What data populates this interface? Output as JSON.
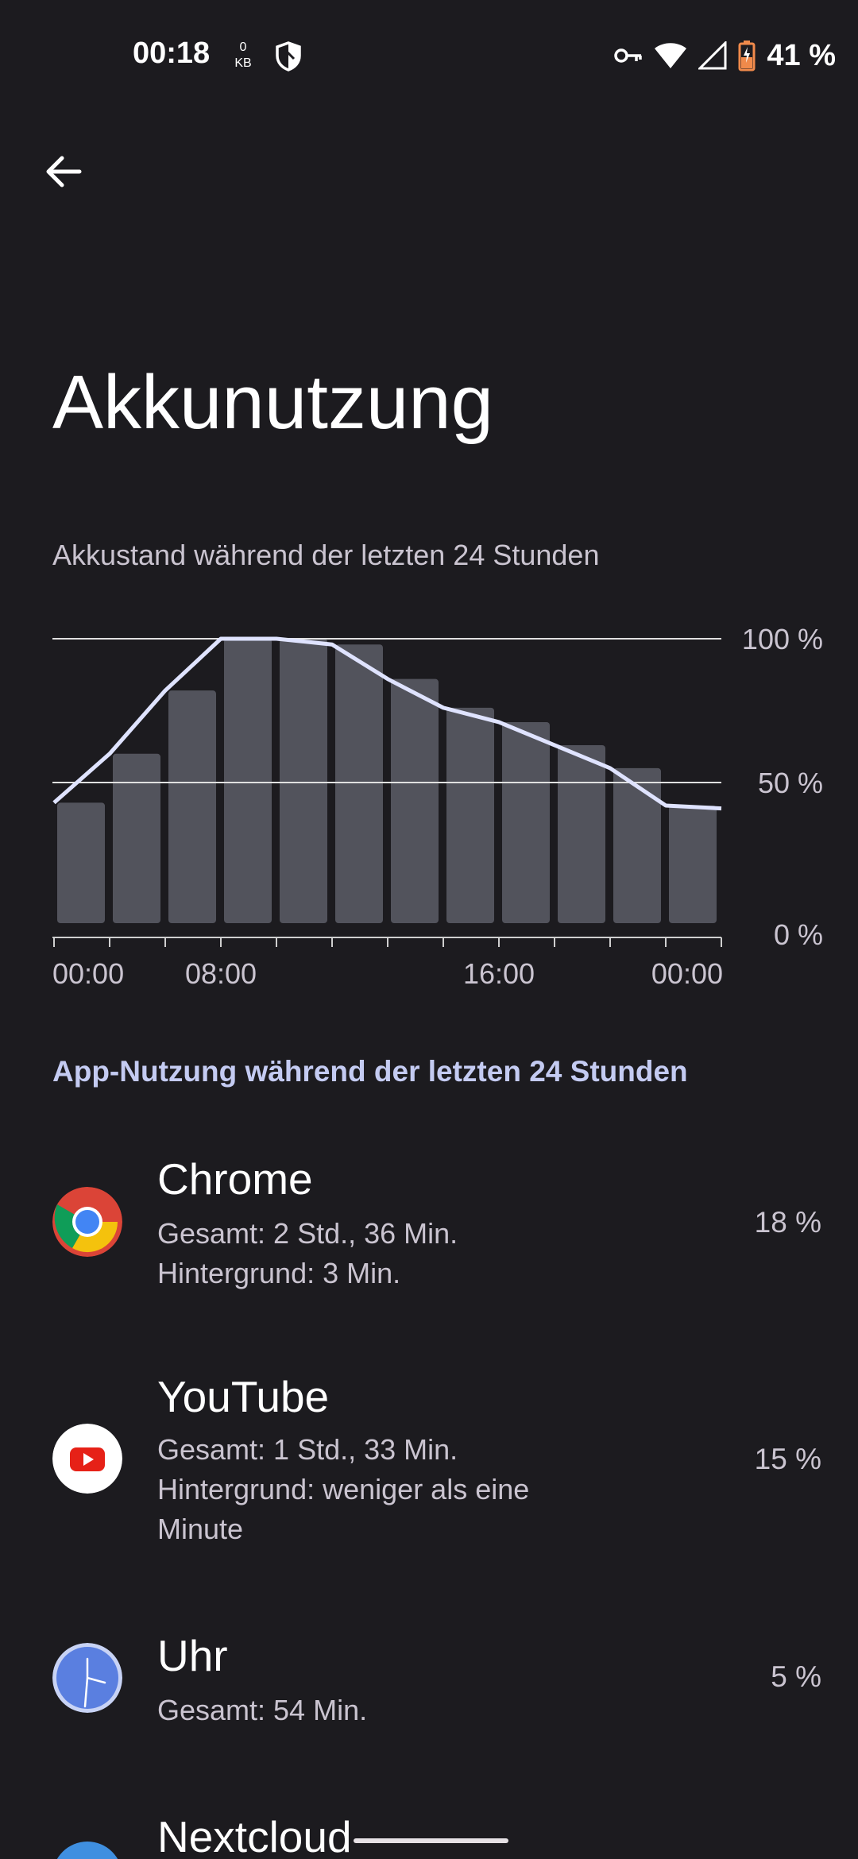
{
  "status_bar": {
    "time": "00:18",
    "data_speed_value": "0",
    "data_speed_unit": "KB",
    "battery_percent": "41 %",
    "icons": [
      "shield-icon",
      "vpn-key-icon",
      "wifi-icon",
      "cell-signal-icon",
      "battery-charging-icon"
    ]
  },
  "header": {
    "back_icon": "arrow-back-icon",
    "title": "Akkunutzung"
  },
  "battery_chart": {
    "caption": "Akkustand während der letzten 24 Stunden"
  },
  "chart_data": {
    "type": "area",
    "title": "Akkustand während der letzten 24 Stunden",
    "xlabel": "",
    "ylabel": "",
    "ylim": [
      0,
      100
    ],
    "y_ticks": [
      "100 %",
      "50 %",
      "0 %"
    ],
    "x_ticks": [
      "00:00",
      "08:00",
      "16:00",
      "00:00"
    ],
    "line_x_hours": [
      0,
      2,
      4,
      6,
      8,
      10,
      12,
      14,
      16,
      18,
      20,
      22,
      24
    ],
    "line_values": [
      43,
      60,
      82,
      100,
      100,
      98,
      86,
      76,
      71,
      63,
      55,
      42,
      41
    ],
    "bars": [
      43,
      60,
      82,
      100,
      100,
      98,
      86,
      76,
      71,
      63,
      55,
      42
    ],
    "colors": {
      "line": "#dfe3ff",
      "bar": "#52535c",
      "grid": "#e0e0e0"
    },
    "grid": true
  },
  "app_usage": {
    "section_title": "App-Nutzung während der letzten 24 Stunden",
    "apps": [
      {
        "name": "Chrome",
        "icon": "chrome-icon",
        "lines": [
          "Gesamt: 2 Std., 36 Min.",
          "Hintergrund: 3 Min."
        ],
        "percent": "18 %"
      },
      {
        "name": "YouTube",
        "icon": "youtube-icon",
        "lines": [
          "Gesamt: 1 Std., 33 Min.",
          "Hintergrund: weniger als eine Minute"
        ],
        "percent": "15 %"
      },
      {
        "name": "Uhr",
        "icon": "clock-icon",
        "lines": [
          "Gesamt: 54 Min."
        ],
        "percent": "5 %"
      },
      {
        "name": "Nextcloud",
        "icon": "nextcloud-icon",
        "lines": [],
        "percent": ""
      }
    ]
  }
}
